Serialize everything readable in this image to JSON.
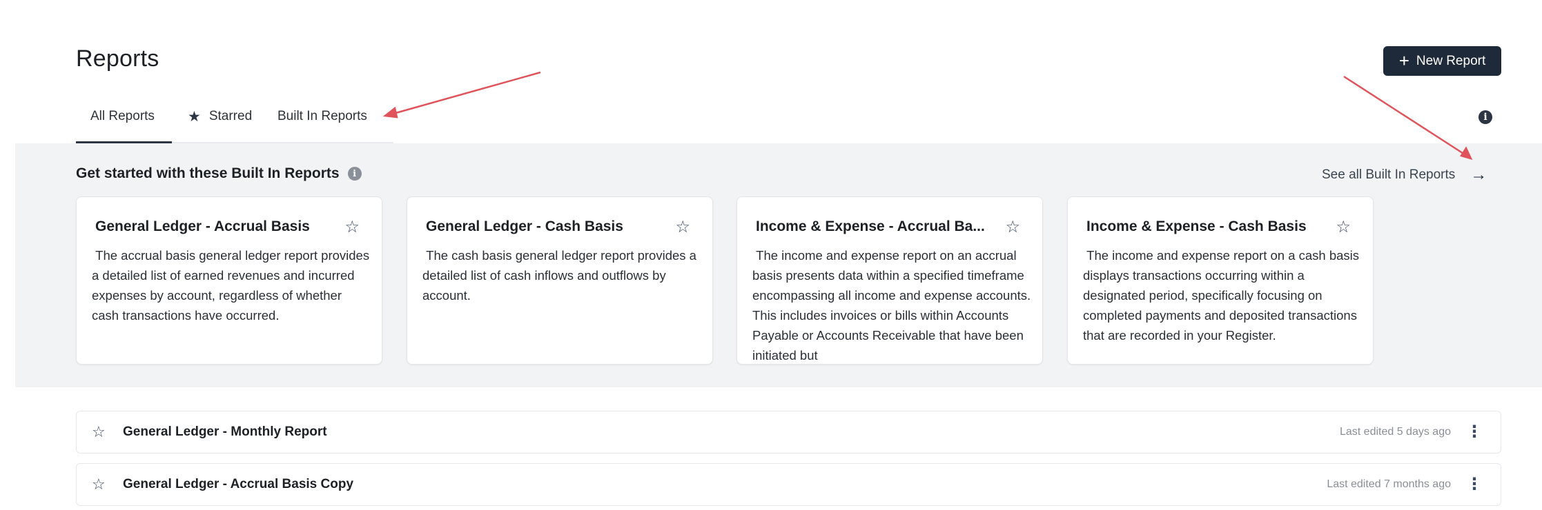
{
  "header": {
    "title": "Reports",
    "new_report_label": "New Report"
  },
  "tabs": [
    {
      "label": "All Reports",
      "active": true
    },
    {
      "label": "Starred",
      "icon": "star-filled-icon"
    },
    {
      "label": "Built In Reports"
    }
  ],
  "builtin": {
    "heading": "Get started with these Built In Reports",
    "see_all_label": "See all Built In Reports",
    "cards": [
      {
        "title": "General Ledger - Accrual Basis",
        "description": " The accrual basis general ledger report provides a detailed list of earned revenues and incurred expenses by account, regardless of whether cash transactions have occurred."
      },
      {
        "title": "General Ledger - Cash Basis",
        "description": " The cash basis general ledger report provides a detailed list of cash inflows and outflows by account."
      },
      {
        "title": "Income & Expense - Accrual Ba...",
        "description": " The income and expense report on an accrual basis presents data within a specified timeframe encompassing all income and expense accounts. This includes invoices or bills within Accounts Payable or Accounts Receivable that have been initiated but"
      },
      {
        "title": "Income & Expense - Cash Basis",
        "description": " The income and expense report on a cash basis displays transactions occurring within a designated period, specifically focusing on completed payments and deposited transactions that are recorded in your Register."
      }
    ]
  },
  "reports": [
    {
      "name": "General Ledger - Monthly Report",
      "last_edited": "Last edited 5 days ago"
    },
    {
      "name": "General Ledger - Accrual Basis Copy",
      "last_edited": "Last edited 7 months ago"
    }
  ],
  "colors": {
    "primary_button": "#1e2a3a",
    "band_background": "#f2f3f5",
    "annotation_arrow": "#e0535a"
  }
}
